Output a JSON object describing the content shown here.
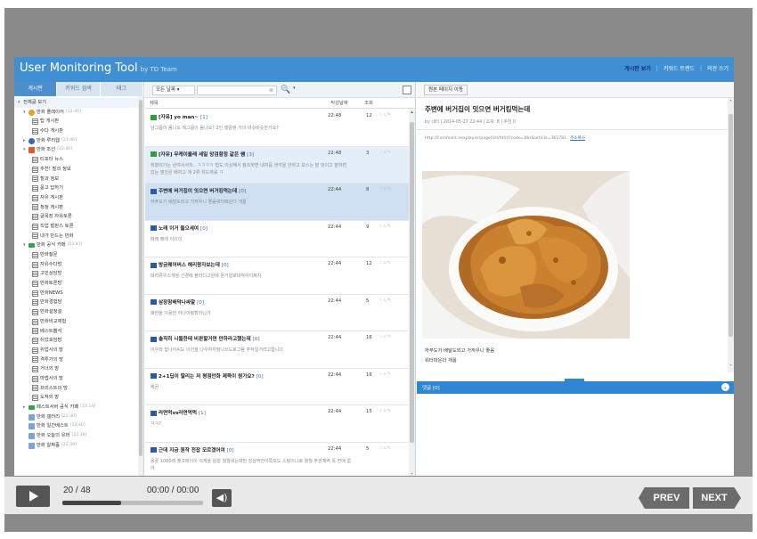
{
  "app": {
    "title": "User Monitoring Tool",
    "subtitle": "by TD Team",
    "top_links": [
      "게시판 보기",
      "키워드 트렌드",
      "의견 쓰기"
    ]
  },
  "sidebar": {
    "tabs": [
      "게시판",
      "키워드 검색",
      "태그"
    ],
    "tree": [
      {
        "label": "전체글 보기",
        "icon": "arrow",
        "count": ""
      },
      {
        "label": "만화 플레이어",
        "icon": "flower",
        "count": "[22:40]"
      },
      {
        "label": "팁 게시판",
        "icon": "board",
        "count": ""
      },
      {
        "label": "수다 게시판",
        "icon": "board",
        "count": ""
      },
      {
        "label": "만화 루리웹",
        "icon": "globe",
        "count": "[21:46]"
      },
      {
        "label": "만화 조선",
        "icon": "orange",
        "count": "[22:40]"
      },
      {
        "label": "티포터 뉴스",
        "icon": "board",
        "count": ""
      },
      {
        "label": "추천! 힐과 정보",
        "icon": "board",
        "count": ""
      },
      {
        "label": "힐과 정보",
        "icon": "board",
        "count": ""
      },
      {
        "label": "묻고 답하기",
        "icon": "board",
        "count": ""
      },
      {
        "label": "자유 게시판",
        "icon": "board",
        "count": ""
      },
      {
        "label": "정정 게시판",
        "icon": "board",
        "count": ""
      },
      {
        "label": "글목장 자유토론",
        "icon": "board",
        "count": ""
      },
      {
        "label": "직업 벌판스 토론",
        "icon": "board",
        "count": ""
      },
      {
        "label": "내가 만드는 만화",
        "icon": "board",
        "count": ""
      },
      {
        "label": "만화 공식 카페",
        "icon": "green",
        "count": "[22:41]"
      },
      {
        "label": "만화질문",
        "icon": "board",
        "count": ""
      },
      {
        "label": "자유수다방",
        "icon": "board",
        "count": ""
      },
      {
        "label": "고민상담방",
        "icon": "board",
        "count": ""
      },
      {
        "label": "만화토론방",
        "icon": "board",
        "count": ""
      },
      {
        "label": "만화NEWS",
        "icon": "board",
        "count": ""
      },
      {
        "label": "만화경험담",
        "icon": "board",
        "count": ""
      },
      {
        "label": "만화설정설",
        "icon": "board",
        "count": ""
      },
      {
        "label": "만화비교체험",
        "icon": "board",
        "count": ""
      },
      {
        "label": "베스트뽑석",
        "icon": "board",
        "count": ""
      },
      {
        "label": "쉬었호암방",
        "icon": "board",
        "count": ""
      },
      {
        "label": "위업사의 방",
        "icon": "board",
        "count": ""
      },
      {
        "label": "격투가의 방",
        "icon": "board",
        "count": ""
      },
      {
        "label": "거너의 방",
        "icon": "board",
        "count": ""
      },
      {
        "label": "마법사의 방",
        "icon": "board",
        "count": ""
      },
      {
        "label": "프리스트의 방",
        "icon": "board",
        "count": ""
      },
      {
        "label": "도적의 방",
        "icon": "board",
        "count": ""
      },
      {
        "label": "페스트서버 공식 카페",
        "icon": "green",
        "count": "[22:14]"
      },
      {
        "label": "만화 갤러리",
        "icon": "gallery",
        "count": "[22:40]"
      },
      {
        "label": "만화 일간베스트",
        "icon": "gallery",
        "count": "[22:40]"
      },
      {
        "label": "만화 오늘의 유머",
        "icon": "gallery",
        "count": "[22:39]"
      },
      {
        "label": "만화 알짜홀",
        "icon": "gallery",
        "count": "[22:39]"
      }
    ]
  },
  "toolbar": {
    "date_select": "모든 날짜",
    "search_placeholder": "",
    "clear": "⊗",
    "search_icon": "🔍",
    "search_opt": "▾"
  },
  "list": {
    "headers": {
      "title": "제목",
      "date": "작성날짜",
      "views": "조회"
    },
    "posts": [
      {
        "badge": "g",
        "title": "[자유] yo man~",
        "num": "[1]",
        "body": "님그룹이 몸나오 에그룹이 몸나요? 2인 행골랜 거의 비슷비슷한가요?",
        "time": "22:48",
        "views": "12",
        "state": ""
      },
      {
        "badge": "g",
        "title": "[자유] 무케이올레 세일 앙검함정 같은 쌤",
        "num": "[3]",
        "body": "취향의가는 상여서서지.. ㅋㅋㅋㅋ 법도 이상해서 참조하면 내여를 생각을 안하고 보스는 말 잊이고 잘하면 있는 영것은 배끼고 게 2위 위드하룰 ㅋ",
        "time": "22:48",
        "views": "3",
        "state": "hl"
      },
      {
        "badge": "b",
        "title": "주변에 버거집이 잇으면 버거킹먹는데",
        "num": "[0]",
        "body": "하푸도가 배달도되고 가까우니 좋음워터파운더 개꿀",
        "time": "22:44",
        "views": "8",
        "state": "sel"
      },
      {
        "badge": "b",
        "title": "노래 이거 들으세여",
        "num": "[0]",
        "body": "페레 페레 이이이",
        "time": "22:44",
        "views": "9",
        "state": ""
      },
      {
        "badge": "b",
        "title": "방금웨어버스 해리왕자보는데",
        "num": "[0]",
        "body": "데리류우스게정 신경에 블라디고원에 몬거알로데작아이쩌지",
        "time": "22:44",
        "views": "12",
        "state": ""
      },
      {
        "badge": "b",
        "title": "삼장참배막나싸말",
        "num": "[0]",
        "body": "왜한을 이용한 하나이링할라닌가",
        "time": "22:44",
        "views": "5",
        "state": ""
      },
      {
        "badge": "b",
        "title": "솔직히 니들한테 비판할거면 만하라고했는데",
        "num": "[0]",
        "body": "이우와 잡나이씨도 이건을 나우하지말나쓰드로그람 주작일거라고합니다",
        "time": "22:44",
        "views": "16",
        "state": ""
      },
      {
        "badge": "b",
        "title": "2+1딥이 딸리는 저 평점만화 제목이 뭔가요?",
        "num": "[0]",
        "body": "제곧",
        "time": "22:44",
        "views": "16",
        "state": ""
      },
      {
        "badge": "b",
        "title": "라면먹vs라면먹먹",
        "num": "[1]",
        "body": "ㅋㅋ?",
        "time": "22:44",
        "views": "15",
        "state": ""
      },
      {
        "badge": "b",
        "title": "근데 지금 원작 전잡 모르겠어여",
        "num": "[0]",
        "body": "몽론 1000레 출고레이이 이게을 원칭 뭘뭘네는데만 앙상막전이쪽모도 스팀이나로 뭘뭘 주관계역 목 전에 없어",
        "time": "22:44",
        "views": "5",
        "state": ""
      }
    ]
  },
  "detail": {
    "orig_button": "원본 페이지 이동",
    "title": "주변에 버거집이 잇으면 버거킹먹는데",
    "meta": "by 네티 | 2014-05-27 22:44 | 조회: 8 | 추천 0",
    "url": "http://comment.nexplay.kr/page/list/html?code=bbs&article=365781",
    "url_link": "주소복사",
    "caption1": "하푸도가 배달도되고 가까우니 좋음",
    "caption2": "워터파운더 개꿀",
    "comments_label": "댓글 [0]",
    "comments_toggle": "⌄"
  },
  "player": {
    "counter": "20 / 48",
    "progress": 0.4167,
    "timer": "00:00 / 00:00",
    "prev": "PREV",
    "next": "NEXT"
  },
  "colors": {
    "header": "#3f8fd2",
    "selected_row": "#cfe0f3",
    "player_buttons": "#6b6b6b"
  }
}
